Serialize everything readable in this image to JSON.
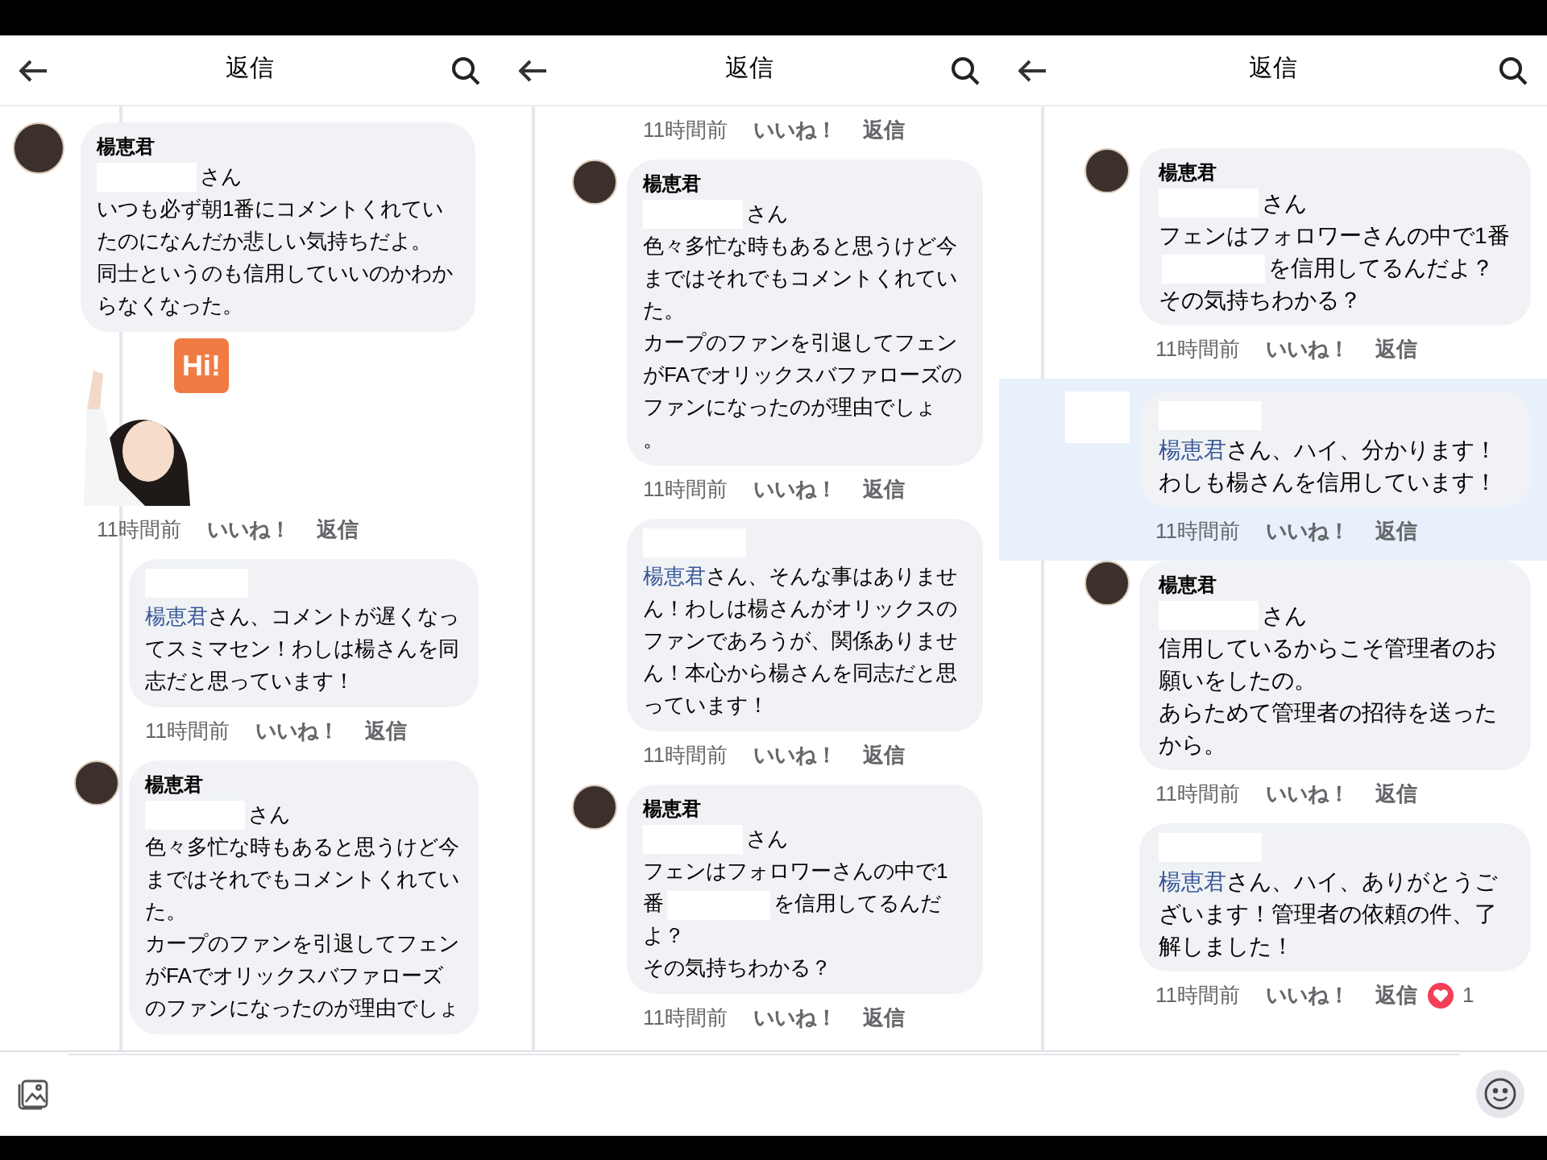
{
  "panels": [
    {
      "title": "返信",
      "comment": {
        "kind": "member",
        "author": "楊恵君",
        "addressee": "さん",
        "paragraphs": [
          [
            "いつも必ず朝1番にコメントくれていたのになんだか悲しい気持ちだよ。"
          ],
          [
            "同士というのも信用していいのかわからなくなった。"
          ]
        ],
        "sticker": {
          "text": "Hi!"
        },
        "time": "11時間前",
        "like": "いいね！",
        "reply": "返信"
      },
      "replies": [
        {
          "kind": "reply",
          "highlighted": false,
          "mention": "楊恵君",
          "paragraphs": [
            [
              "さん、コメントが遅くなってスミマセン！わしは楊さんを同志だと思っています！"
            ]
          ],
          "time": "11時間前",
          "like": "いいね！",
          "reply": "返信"
        },
        {
          "kind": "member",
          "highlighted": false,
          "author": "楊恵君",
          "addressee": "さん",
          "paragraphs": [
            [
              "色々多忙な時もあると思うけど今まではそれでもコメントくれていた。"
            ],
            [
              "カープのファンを引退してフェンがFAでオリックスバファローズのファンになったのが理由でしょ"
            ]
          ]
        }
      ]
    },
    {
      "title": "返信",
      "replies": [
        {
          "kind": "reply",
          "highlighted": false,
          "time": "11時間前",
          "like": "いいね！",
          "reply": "返信"
        },
        {
          "kind": "member",
          "highlighted": false,
          "author": "楊恵君",
          "addressee": "さん",
          "paragraphs": [
            [
              "色々多忙な時もあると思うけど今まではそれでもコメントくれていた。"
            ],
            [
              "カープのファンを引退してフェンがFAでオリックスバファローズのファンになったのが理由でしょ"
            ],
            [
              "。"
            ]
          ],
          "time": "11時間前",
          "like": "いいね！",
          "reply": "返信"
        },
        {
          "kind": "reply",
          "highlighted": false,
          "mention": "楊恵君",
          "paragraphs": [
            [
              "さん、そんな事はありません！わしは楊さんがオリックスのファンであろうが、関係ありません！本心から楊さんを同志だと思っています！"
            ]
          ],
          "time": "11時間前",
          "like": "いいね！",
          "reply": "返信"
        },
        {
          "kind": "member",
          "highlighted": false,
          "author": "楊恵君",
          "addressee": "さん",
          "paragraphs": [
            [
              "フェンはフォロワーさんの中で1番",
              "を信用してるんだよ？"
            ],
            [
              "その気持ちわかる？"
            ]
          ],
          "time": "11時間前",
          "like": "いいね！",
          "reply": "返信"
        }
      ]
    },
    {
      "title": "返信",
      "replies": [
        {
          "kind": "member",
          "highlighted": false,
          "author": "楊恵君",
          "addressee": "さん",
          "paragraphs": [
            [
              "フェンはフォロワーさんの中で1番",
              "を信用してるんだよ？"
            ],
            [
              "その気持ちわかる？"
            ]
          ],
          "time": "11時間前",
          "like": "いいね！",
          "reply": "返信"
        },
        {
          "kind": "reply_with_avatar",
          "highlighted": true,
          "mention": "楊恵君",
          "paragraphs": [
            [
              "さん、ハイ、分かります！"
            ],
            [
              "わしも楊さんを信用しています！"
            ]
          ],
          "time": "11時間前",
          "like": "いいね！",
          "reply": "返信"
        },
        {
          "kind": "member",
          "highlighted": false,
          "author": "楊恵君",
          "addressee": "さん",
          "paragraphs": [
            [
              "信用しているからこそ管理者のお願いをしたの。"
            ],
            [
              "あらためて管理者の招待を送ったから。"
            ]
          ],
          "time": "11時間前",
          "like": "いいね！",
          "reply": "返信"
        },
        {
          "kind": "reply",
          "highlighted": false,
          "mention": "楊恵君",
          "paragraphs": [
            [
              "さん、ハイ、ありがとうございます！管理者の依頼の件、了解しました！"
            ]
          ],
          "time": "11時間前",
          "like": "いいね！",
          "reply": "返信",
          "reactions": "1"
        }
      ]
    }
  ]
}
